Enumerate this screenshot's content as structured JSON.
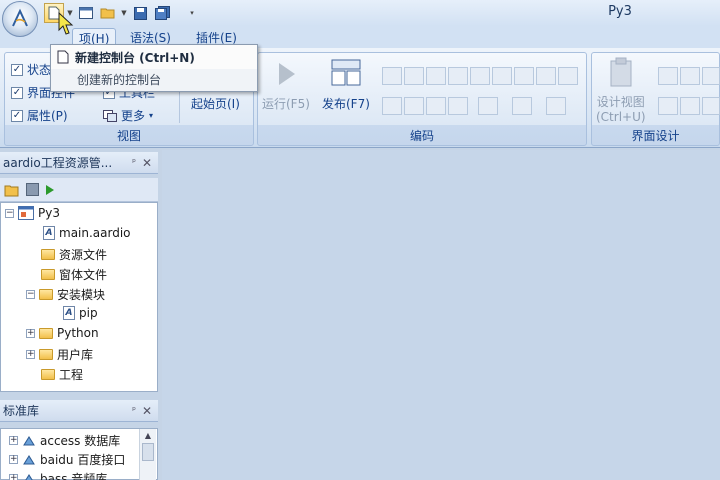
{
  "window": {
    "title": "Py3"
  },
  "tabs": [
    {
      "label": "项(H)",
      "active": true
    },
    {
      "label": "语法(S)",
      "active": false
    },
    {
      "label": "插件(E)",
      "active": false
    }
  ],
  "ribbon": {
    "view_group": {
      "label": "视图",
      "checks": [
        {
          "label": "状态",
          "checked": true
        },
        {
          "label": "界面控件",
          "checked": true
        },
        {
          "label": "属性(P)",
          "checked": true
        }
      ],
      "extra_label": "工具栏",
      "more_label": "更多",
      "start_page_label": "起始页(I)"
    },
    "code_group": {
      "label": "编码",
      "run_label": "运行(F5)",
      "publish_label": "发布(F7)"
    },
    "ui_group": {
      "label": "界面设计",
      "design_label": "设计视图",
      "design_shortcut": "(Ctrl+U)"
    }
  },
  "menu": {
    "item_label": "新建控制台 (Ctrl+N)",
    "item_desc": "创建新的控制台"
  },
  "project_pane": {
    "title": "aardio工程资源管...",
    "tree": [
      {
        "label": "Py3",
        "kind": "project",
        "level": 0,
        "expander": "−"
      },
      {
        "label": "main.aardio",
        "kind": "file",
        "level": 1
      },
      {
        "label": "资源文件",
        "kind": "folder",
        "level": 1
      },
      {
        "label": "窗体文件",
        "kind": "folder",
        "level": 1
      },
      {
        "label": "安装模块",
        "kind": "folder",
        "level": 1,
        "expander": "−"
      },
      {
        "label": "pip",
        "kind": "file",
        "level": 2
      },
      {
        "label": "Python",
        "kind": "folder",
        "level": 1,
        "expander": "+"
      },
      {
        "label": "用户库",
        "kind": "folder",
        "level": 1,
        "expander": "+"
      },
      {
        "label": "工程",
        "kind": "folder",
        "level": 1
      }
    ]
  },
  "library_pane": {
    "title": "标准库",
    "items": [
      {
        "label": "access 数据库"
      },
      {
        "label": "baidu 百度接口"
      },
      {
        "label": "bass 音频库"
      }
    ]
  },
  "colors": {
    "ribbon_text": "#15428b",
    "workspace_bg": "#c6d6e9",
    "highlight": "#ffd767"
  }
}
